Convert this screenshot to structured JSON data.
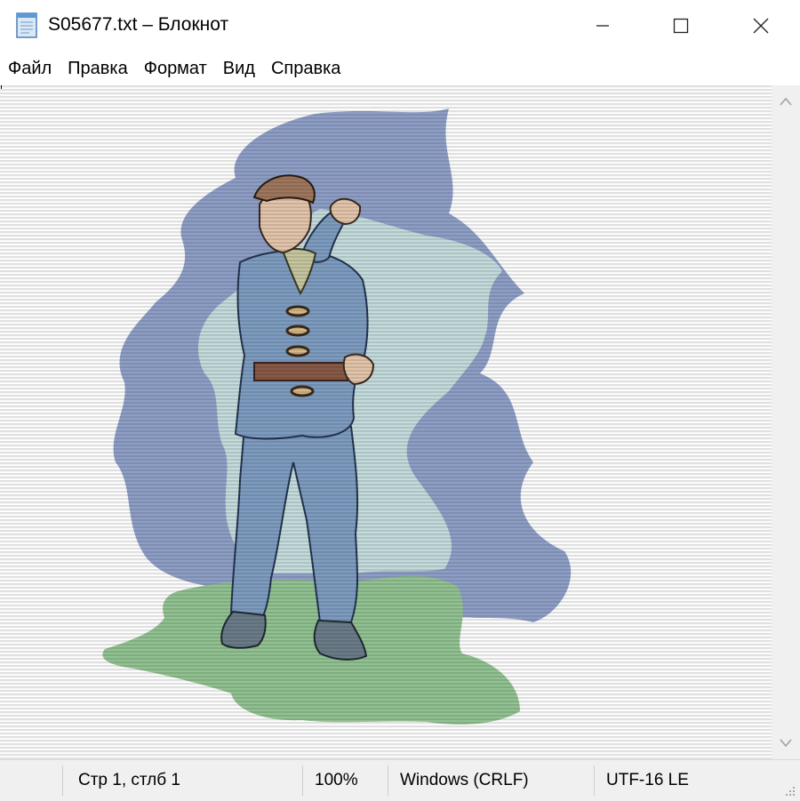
{
  "window": {
    "title": "S05677.txt – Блокнот",
    "icon": "notepad-icon",
    "controls": [
      "minimize-icon",
      "maximize-icon",
      "close-icon"
    ]
  },
  "menu": {
    "items": [
      {
        "label": "Файл"
      },
      {
        "label": "Правка"
      },
      {
        "label": "Формат"
      },
      {
        "label": "Вид"
      },
      {
        "label": "Справка"
      }
    ]
  },
  "status": {
    "position": "Стр 1, стлб 1",
    "zoom": "100%",
    "line_endings": "Windows (CRLF)",
    "encoding": "UTF-16 LE"
  },
  "colors": {
    "sky_blue": "#8fa0c8",
    "mist": "#c6dede",
    "grass": "#93c493",
    "suit": "#7f9ec2",
    "skin": "#e6c7ad"
  }
}
